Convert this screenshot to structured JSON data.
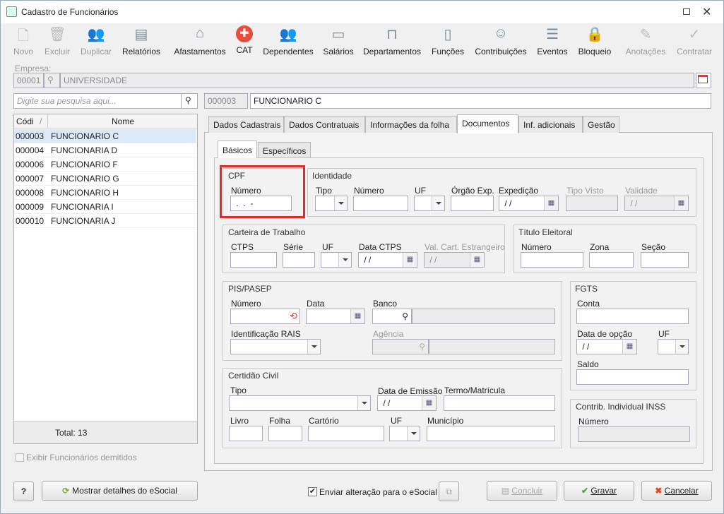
{
  "window": {
    "title": "Cadastro de Funcionários"
  },
  "toolbar": {
    "items": [
      {
        "label": "Novo",
        "enabled": false,
        "icon": "new-doc-icon"
      },
      {
        "label": "Excluir",
        "enabled": false,
        "icon": "trash-icon"
      },
      {
        "label": "Duplicar",
        "enabled": false,
        "icon": "duplicate-users-icon"
      },
      {
        "label": "Relatórios",
        "enabled": true,
        "icon": "report-icon"
      },
      {
        "label": "Afastamentos",
        "enabled": true,
        "icon": "house-arrow-icon"
      },
      {
        "label": "CAT",
        "enabled": true,
        "icon": "red-cross-icon"
      },
      {
        "label": "Dependentes",
        "enabled": true,
        "icon": "people-icon"
      },
      {
        "label": "Salários",
        "enabled": true,
        "icon": "money-icon"
      },
      {
        "label": "Departamentos",
        "enabled": true,
        "icon": "desk-icon"
      },
      {
        "label": "Funções",
        "enabled": true,
        "icon": "badge-icon"
      },
      {
        "label": "Contribuições",
        "enabled": true,
        "icon": "heads-icon"
      },
      {
        "label": "Eventos",
        "enabled": true,
        "icon": "list-icon"
      },
      {
        "label": "Bloqueio",
        "enabled": true,
        "icon": "lock-icon"
      },
      {
        "label": "Anotações",
        "enabled": false,
        "icon": "note-icon"
      },
      {
        "label": "Contratar",
        "enabled": false,
        "icon": "contract-icon"
      }
    ]
  },
  "empresa": {
    "label": "Empresa:",
    "code": "00001",
    "name": "UNIVERSIDADE"
  },
  "search": {
    "placeholder": "Digite sua pesquisa aqui..."
  },
  "current": {
    "code": "000003",
    "name": "FUNCIONARIO C"
  },
  "list": {
    "col_code": "Códi",
    "col_name": "Nome",
    "sort": "/",
    "rows": [
      {
        "code": "000003",
        "name": "FUNCIONARIO C"
      },
      {
        "code": "000004",
        "name": "FUNCIONARIA D"
      },
      {
        "code": "000006",
        "name": "FUNCIONARIO F"
      },
      {
        "code": "000007",
        "name": "FUNCIONARIO G"
      },
      {
        "code": "000008",
        "name": "FUNCIONARIO H"
      },
      {
        "code": "000009",
        "name": "FUNCIONARIA I"
      },
      {
        "code": "000010",
        "name": "FUNCIONARIA J"
      }
    ],
    "total": "Total: 13"
  },
  "show_dismissed": "Exibir Funcionários demitidos",
  "tabs": [
    "Dados Cadastrais",
    "Dados Contratuais",
    "Informações da folha",
    "Documentos",
    "Inf. adicionais",
    "Gestão"
  ],
  "subtabs": [
    "Básicos",
    "Específicos"
  ],
  "cpf": {
    "title": "CPF",
    "numero_label": "Número",
    "numero_value": " .  .  -"
  },
  "identidade": {
    "title": "Identidade",
    "tipo": "Tipo",
    "numero": "Número",
    "uf": "UF",
    "orgao": "Órgão Exp.",
    "expedicao": "Expedição",
    "expedicao_value": " / /",
    "tipo_visto": "Tipo Visto",
    "validade": "Validade",
    "validade_value": " / /"
  },
  "ctps": {
    "title": "Carteira de Trabalho",
    "ctps": "CTPS",
    "serie": "Série",
    "uf": "UF",
    "data": "Data CTPS",
    "data_value": " / /",
    "val": "Val. Cart. Estrangeiro",
    "val_value": " / /"
  },
  "titulo": {
    "title": "Título Eleitoral",
    "numero": "Número",
    "zona": "Zona",
    "secao": "Seção"
  },
  "pis": {
    "title": "PIS/PASEP",
    "numero": "Número",
    "data": "Data",
    "banco": "Banco",
    "rais": "Identificação RAIS",
    "agencia": "Agência"
  },
  "fgts": {
    "title": "FGTS",
    "conta": "Conta",
    "data_opcao": "Data de opção",
    "data_value": " / /",
    "uf": "UF",
    "saldo": "Saldo"
  },
  "certidao": {
    "title": "Certidão Civil",
    "tipo": "Tipo",
    "emissao": "Data de Emissão",
    "emissao_value": " / /",
    "termo": "Termo/Matrícula",
    "livro": "Livro",
    "folha": "Folha",
    "cartorio": "Cartório",
    "uf": "UF",
    "municipio": "Município"
  },
  "inss": {
    "title": "Contrib. Individual INSS",
    "numero": "Número"
  },
  "footer": {
    "help": "?",
    "esocial_details": "Mostrar detalhes do eSocial",
    "send_esocial": "Enviar alteração para o eSocial",
    "concluir": "Concluir",
    "gravar": "Gravar",
    "cancelar": "Cancelar"
  }
}
